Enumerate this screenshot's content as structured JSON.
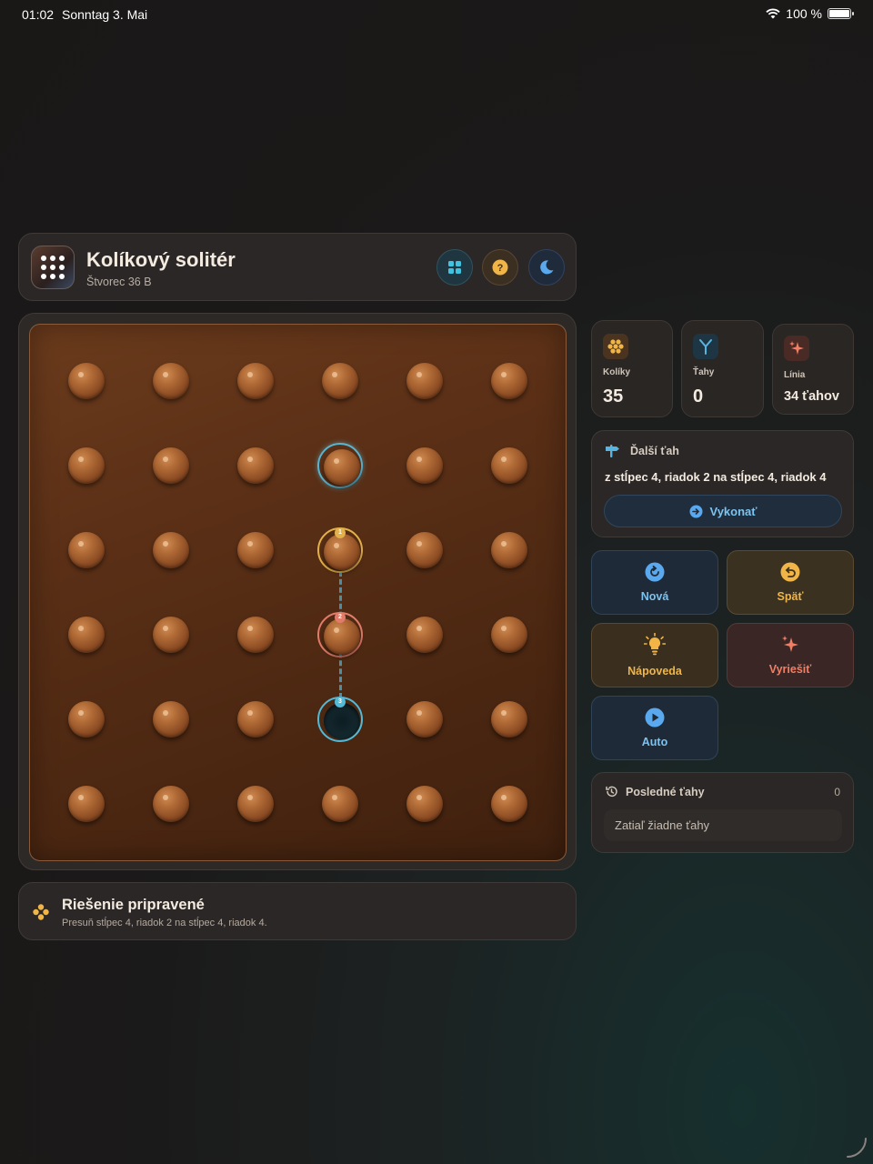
{
  "status_bar": {
    "time": "01:02",
    "date": "Sonntag 3. Mai",
    "battery": "100 %"
  },
  "header": {
    "title": "Kolíkový solitér",
    "subtitle": "Štvorec 36 B"
  },
  "board": {
    "rows": 6,
    "cols": 6,
    "empty_cells": [
      [
        4,
        3
      ]
    ],
    "selected_cell": [
      1,
      3
    ],
    "suggested_move": {
      "from": [
        2,
        3
      ],
      "over": [
        3,
        3
      ],
      "to": [
        4,
        3
      ]
    },
    "badges": {
      "from": "1",
      "over": "2",
      "to": "3"
    }
  },
  "status": {
    "title": "Riešenie pripravené",
    "description": "Presuň stĺpec 4, riadok 2 na stĺpec 4, riadok 4."
  },
  "stats": {
    "pegs": {
      "label": "Kolíky",
      "value": "35"
    },
    "moves": {
      "label": "Ťahy",
      "value": "0"
    },
    "line": {
      "label": "Línia",
      "value": "34 ťahov"
    }
  },
  "next_move": {
    "heading": "Ďalší ťah",
    "text": "z stĺpec 4, riadok 2 na stĺpec 4, riadok 4",
    "execute_label": "Vykonať"
  },
  "actions": {
    "new_label": "Nová",
    "undo_label": "Späť",
    "hint_label": "Nápoveda",
    "solve_label": "Vyriešiť",
    "auto_label": "Auto"
  },
  "recent": {
    "heading": "Posledné ťahy",
    "count": "0",
    "empty_text": "Zatiaľ žiadne ťahy"
  },
  "colors": {
    "accent_blue": "#7cc3ef",
    "accent_amber": "#f0b546",
    "accent_coral": "#f07f66",
    "wood": "#5a2f16"
  }
}
